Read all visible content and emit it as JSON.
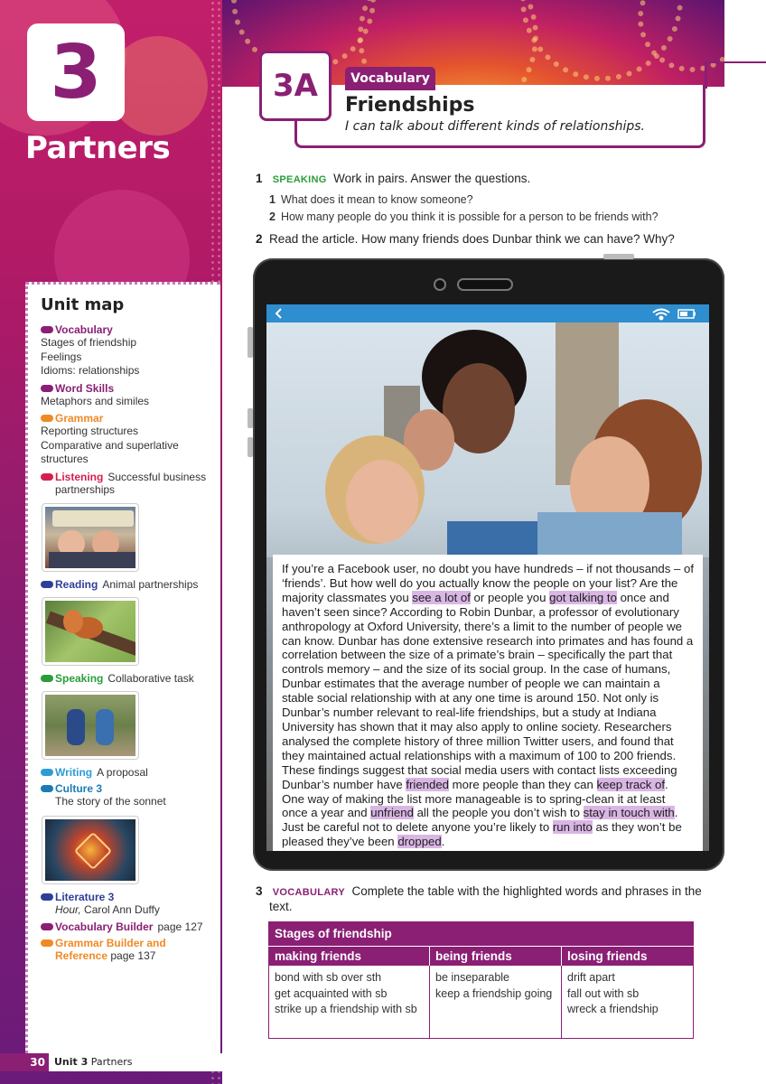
{
  "sidebar": {
    "unit_number": "3",
    "unit_title": "Partners",
    "map_title": "Unit map",
    "sections": [
      {
        "category": "Vocabulary",
        "color": "#8a1f74",
        "inline": "",
        "lines": [
          "Stages of friendship",
          "Feelings",
          "Idioms: relationships"
        ]
      },
      {
        "category": "Word Skills",
        "color": "#8a1f74",
        "inline": "",
        "lines": [
          "Metaphors and similes"
        ]
      },
      {
        "category": "Grammar",
        "color": "#f08a24",
        "inline": "",
        "lines": [
          "Reporting structures",
          "Comparative and superlative",
          "structures"
        ]
      },
      {
        "category": "Listening",
        "color": "#d4204e",
        "inline": "Successful business",
        "lines": [
          "partnerships"
        ]
      },
      {
        "category": "Reading",
        "color": "#2e3f99",
        "inline": "Animal partnerships",
        "lines": []
      },
      {
        "category": "Speaking",
        "color": "#2a9d3a",
        "inline": "Collaborative task",
        "lines": []
      },
      {
        "category": "Writing",
        "color": "#2d9cd6",
        "inline": "A proposal",
        "lines": []
      },
      {
        "category": "Culture 3",
        "color": "#1d7ab5",
        "inline": "",
        "lines": [
          "The story of the sonnet"
        ]
      },
      {
        "category": "Literature 3",
        "color": "#2e3f99",
        "inline": "",
        "lines_italic": "Hour,",
        "lines_rest": " Carol Ann Duffy"
      },
      {
        "category": "Vocabulary Builder",
        "color": "#8a1f74",
        "inline": "page 127"
      },
      {
        "category": "Grammar Builder and",
        "color": "#f08a24",
        "line2_bold": "Reference",
        "line2_rest": "page 137"
      }
    ]
  },
  "footer": {
    "page_number": "30",
    "unit": "Unit 3",
    "title": "Partners"
  },
  "lesson": {
    "code": "3A",
    "tab": "Vocabulary",
    "title": "Friendships",
    "aim": "I can talk about different kinds of relationships."
  },
  "exercise1": {
    "number": "1",
    "keyword": "SPEAKING",
    "instruction": "Work in pairs. Answer the questions.",
    "questions": [
      {
        "n": "1",
        "text": "What does it mean to know someone?"
      },
      {
        "n": "2",
        "text": "How many people do you think it is possible for a person to be friends with?"
      }
    ]
  },
  "exercise2": {
    "number": "2",
    "instruction": "Read the article. How many friends does Dunbar think we can have? Why?"
  },
  "article": {
    "segments": [
      {
        "t": "If you’re a Facebook user, no doubt you have hundreds – if not thousands – of ‘friends’. But how well do you actually know the people on your list? Are the majority classmates you "
      },
      {
        "t": "see a lot of",
        "hl": true
      },
      {
        "t": " or people you "
      },
      {
        "t": "got talking to",
        "hl": true
      },
      {
        "t": " once and haven’t seen since? According to Robin Dunbar, a professor of evolutionary anthropology at Oxford University, there’s a limit to the number of people we can know. Dunbar has done extensive research into primates and has found a correlation between the size of a primate’s brain – specifically the part that controls memory – and the size of its social group. In the case of humans, Dunbar estimates that the average number of people we can maintain a stable social relationship with at any one time is around 150. Not only is Dunbar’s number relevant to real-life friendships, but a study at Indiana University has shown that it may also apply to online society. Researchers analysed the complete history of three million Twitter users, and found that they maintained actual relationships with a maximum of 100 to 200 friends. These findings suggest that social media users with contact lists exceeding Dunbar’s number have "
      },
      {
        "t": "friended",
        "hl": true
      },
      {
        "t": " more people than they can "
      },
      {
        "t": "keep track of",
        "hl": true
      },
      {
        "t": ". One way of making the list more manageable is to spring-clean it at least once a year and "
      },
      {
        "t": "unfriend",
        "hl": true
      },
      {
        "t": " all the people you don’t wish to "
      },
      {
        "t": "stay in touch with",
        "hl": true
      },
      {
        "t": ". Just be careful not to delete anyone you’re likely to "
      },
      {
        "t": "run into",
        "hl": true
      },
      {
        "t": " as they won’t be pleased they’ve been "
      },
      {
        "t": "dropped",
        "hl": true
      },
      {
        "t": "."
      }
    ]
  },
  "exercise3": {
    "number": "3",
    "keyword": "VOCABULARY",
    "instruction": "Complete the table with the highlighted words and phrases in the",
    "instruction2": "text.",
    "table": {
      "title": "Stages of friendship",
      "columns": [
        {
          "header": "making friends",
          "items": [
            "bond with sb over sth",
            "get acquainted with sb",
            "strike up a friendship with sb"
          ]
        },
        {
          "header": "being friends",
          "items": [
            "be inseparable",
            "keep a friendship going"
          ]
        },
        {
          "header": "losing friends",
          "items": [
            "drift apart",
            "fall out with sb",
            "wreck a friendship"
          ]
        }
      ]
    }
  }
}
